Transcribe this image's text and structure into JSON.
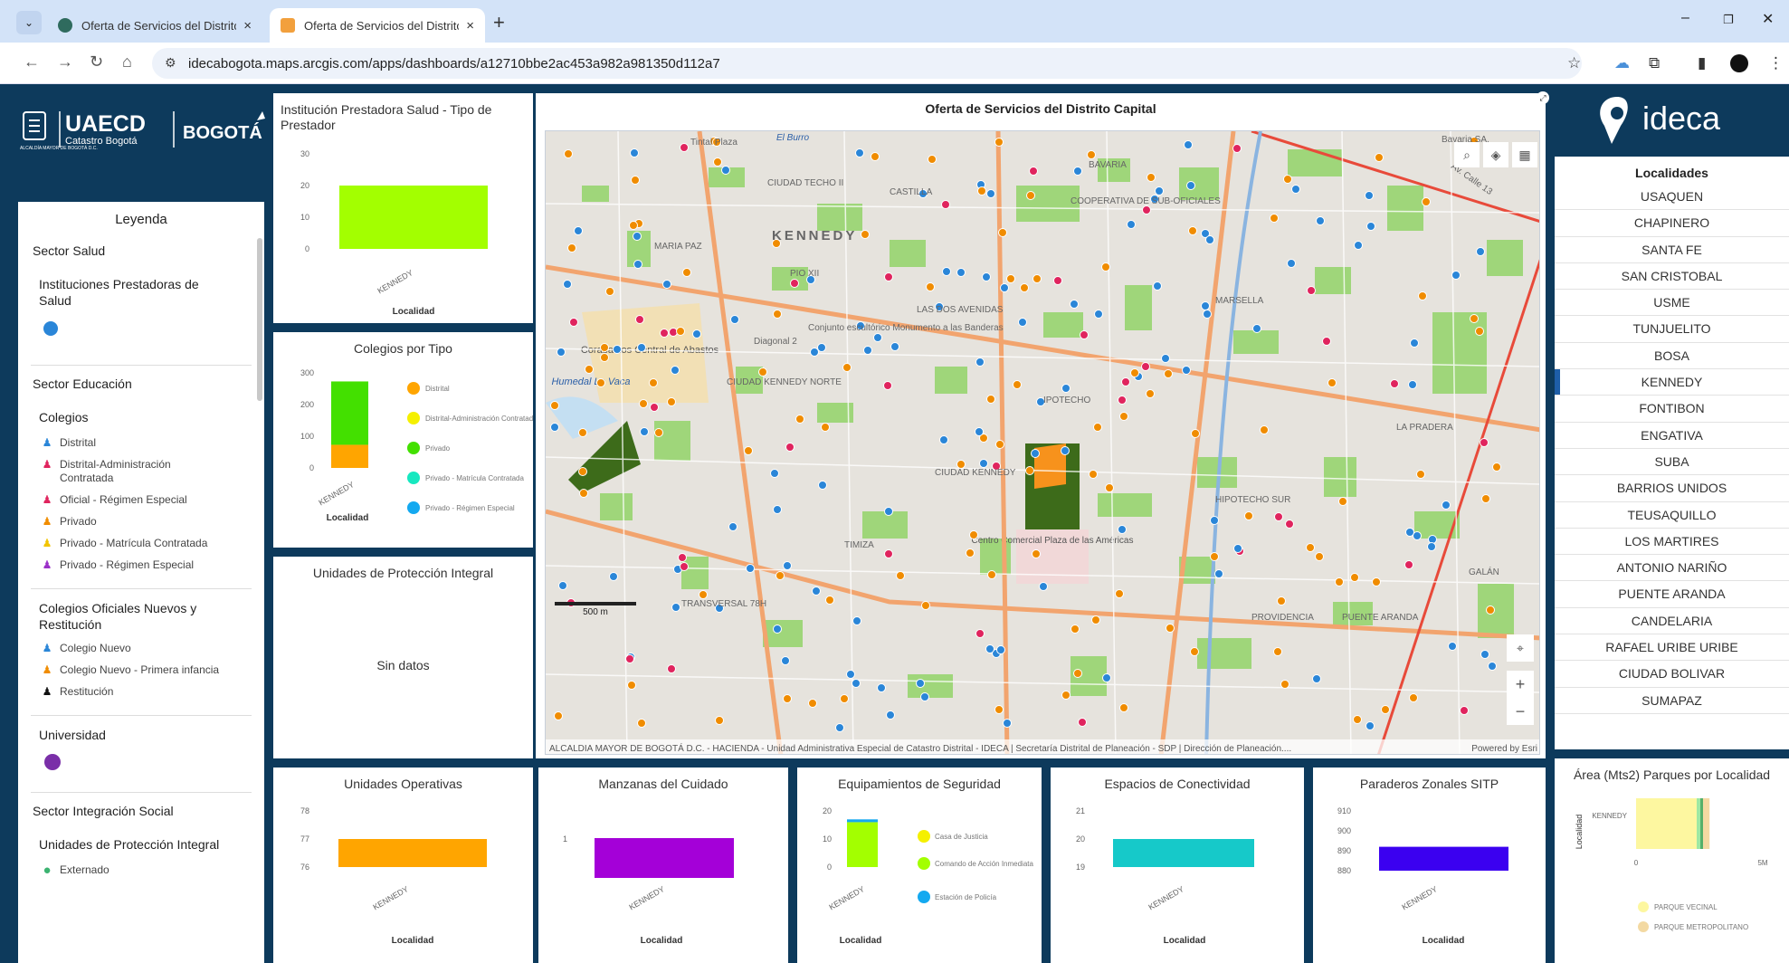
{
  "browser": {
    "tabs": [
      {
        "title": "Oferta de Servicios del Distrito",
        "close": "×"
      },
      {
        "title": "Oferta de Servicios del Distrito",
        "close": "×"
      }
    ],
    "new_tab": "+",
    "url": "idecabogota.maps.arcgis.com/apps/dashboards/a12710bbe2ac453a982a981350d112a7",
    "window_controls": {
      "minimize": "–",
      "restore": "❐",
      "close": "✕"
    }
  },
  "branding": {
    "uaecd": "UAECD",
    "catastro": "Catastro Bogotá",
    "alcaldia": "ALCALDÍA MAYOR DE BOGOTÁ D.C.",
    "bogota": "BOGOTÁ",
    "ideca": "ideca"
  },
  "legend": {
    "title": "Leyenda",
    "salud": {
      "sector": "Sector Salud",
      "sub": "Instituciones Prestadoras de Salud"
    },
    "educacion": {
      "sector": "Sector Educación",
      "colegios": "Colegios",
      "items": [
        "Distrital",
        "Distrital-Administración Contratada",
        "Oficial - Régimen Especial",
        "Privado",
        "Privado - Matrícula Contratada",
        "Privado - Régimen Especial"
      ],
      "nuevos": "Colegios Oficiales Nuevos y Restitución",
      "nuevos_items": [
        "Colegio Nuevo",
        "Colegio Nuevo - Primera infancia",
        "Restitución"
      ],
      "universidad": "Universidad"
    },
    "integracion": {
      "sector": "Sector Integración Social",
      "sub": "Unidades de Protección Integral",
      "items": [
        "Externado"
      ]
    }
  },
  "colors": {
    "navy": "#0d3a5c",
    "lime": "#a3ff00",
    "orange": "#ffa500",
    "purple": "#a400d8",
    "cyan": "#16c9c9",
    "blue": "#3b00f0",
    "accent": "#1e5ea8"
  },
  "ips_chart": {
    "title": "Institución Prestadora Salud - Tipo de Prestador",
    "ticks": [
      "30",
      "20",
      "10",
      "0"
    ],
    "category": "KENNEDY",
    "xlabel": "Localidad",
    "chart_data": {
      "type": "bar",
      "categories": [
        "KENNEDY"
      ],
      "values": [
        20
      ],
      "xlabel": "Localidad",
      "ylim": [
        0,
        30
      ]
    }
  },
  "colegios_chart": {
    "title": "Colegios por Tipo",
    "ticks": [
      "300",
      "200",
      "100",
      "0"
    ],
    "category": "KENNEDY",
    "xlabel": "Localidad",
    "legend": [
      "Distrital",
      "Distrital-Administración Contratada",
      "Privado",
      "Privado - Matrícula Contratada",
      "Privado - Régimen Especial"
    ],
    "chart_data": {
      "type": "bar",
      "stacked": true,
      "categories": [
        "KENNEDY"
      ],
      "series": [
        {
          "name": "Distrital",
          "values": [
            73
          ]
        },
        {
          "name": "Privado",
          "values": [
            200
          ]
        }
      ],
      "xlabel": "Localidad",
      "ylim": [
        0,
        300
      ]
    }
  },
  "upi_panel": {
    "title": "Unidades de Protección Integral",
    "empty": "Sin datos"
  },
  "map": {
    "title": "Oferta de Servicios del Distrito Capital",
    "labels": [
      "KENNEDY",
      "CIUDAD TECHO II",
      "COOPERATIVA DE SUB-OFICIALES",
      "Corabastos Central de Abastos",
      "Humedal La Vaca",
      "CIUDAD KENNEDY NORTE",
      "LAS DOS AVENIDAS",
      "PIO XII",
      "TIMIZA",
      "IPOTECHO",
      "CIUDAD KENNEDY",
      "Centro Comercial Plaza de las Américas",
      "HIPOTECHO SUR",
      "LA PRADERA",
      "MARSELLA",
      "Av. Calle 13",
      "Bavaria SA.",
      "El Burro",
      "Tintal Plaza",
      "MARIA PAZ",
      "CASTILLA",
      "Conjunto escultórico Monumento a las Banderas",
      "Diagonal 2",
      "PROVIDENCIA",
      "GALÁN",
      "PUENTE ARANDA",
      "TRANSVERSAL 78H",
      "BAVARIA"
    ],
    "scale": "500 m",
    "attribution": "ALCALDIA MAYOR DE BOGOTÁ D.C. - HACIENDA - Unidad Administrativa Especial de Catastro Distrital - IDECA | Secretaría Distrital de Planeación - SDP | Dirección de Planeación....",
    "powered": "Powered by Esri"
  },
  "localidades": {
    "title": "Localidades",
    "items": [
      "USAQUEN",
      "CHAPINERO",
      "SANTA FE",
      "SAN CRISTOBAL",
      "USME",
      "TUNJUELITO",
      "BOSA",
      "KENNEDY",
      "FONTIBON",
      "ENGATIVA",
      "SUBA",
      "BARRIOS UNIDOS",
      "TEUSAQUILLO",
      "LOS MARTIRES",
      "ANTONIO NARIÑO",
      "PUENTE ARANDA",
      "CANDELARIA",
      "RAFAEL URIBE URIBE",
      "CIUDAD BOLIVAR",
      "SUMAPAZ"
    ],
    "selected": "KENNEDY"
  },
  "bottom": {
    "operativas": {
      "title": "Unidades Operativas",
      "ticks": [
        "78",
        "77",
        "76"
      ],
      "chart_data": {
        "type": "bar",
        "categories": [
          "KENNEDY"
        ],
        "values": [
          77
        ],
        "xlabel": "Localidad",
        "ylim": [
          76,
          78
        ]
      }
    },
    "manzanas": {
      "title": "Manzanas del Cuidado",
      "ticks": [
        "1"
      ],
      "chart_data": {
        "type": "bar",
        "categories": [
          "KENNEDY"
        ],
        "values": [
          1
        ],
        "xlabel": "Localidad"
      }
    },
    "seguridad": {
      "title": "Equipamientos de Seguridad",
      "ticks": [
        "20",
        "10",
        "0"
      ],
      "legend": [
        "Casa de Justicia",
        "Comando de Acción Inmediata",
        "Estación de Policía"
      ],
      "chart_data": {
        "type": "bar",
        "stacked": true,
        "categories": [
          "KENNEDY"
        ],
        "series": [
          {
            "name": "Comando de Acción Inmediata",
            "values": [
              16
            ]
          },
          {
            "name": "Estación de Policía",
            "values": [
              1
            ]
          }
        ],
        "xlabel": "Localidad",
        "ylim": [
          0,
          20
        ]
      }
    },
    "conectividad": {
      "title": "Espacios de Conectividad",
      "ticks": [
        "21",
        "20",
        "19"
      ],
      "chart_data": {
        "type": "bar",
        "categories": [
          "KENNEDY"
        ],
        "values": [
          20
        ],
        "xlabel": "Localidad",
        "ylim": [
          19,
          21
        ]
      }
    },
    "paraderos": {
      "title": "Paraderos Zonales SITP",
      "ticks": [
        "910",
        "900",
        "890",
        "880"
      ],
      "chart_data": {
        "type": "bar",
        "categories": [
          "KENNEDY"
        ],
        "values": [
          892
        ],
        "xlabel": "Localidad",
        "ylim": [
          880,
          910
        ]
      }
    },
    "parques": {
      "title": "Área (Mts2) Parques por Localidad",
      "ylabel": "Localidad",
      "ticks": [
        "0",
        "5M"
      ],
      "legend": [
        "PARQUE VECINAL",
        "PARQUE METROPOLITANO"
      ],
      "chart_data": {
        "type": "bar",
        "horizontal": true,
        "categories": [
          "KENNEDY"
        ],
        "series": [
          {
            "name": "PARQUE VECINAL",
            "values": [
              2500000
            ]
          },
          {
            "name": "PARQUE METROPOLITANO",
            "values": [
              400000
            ]
          }
        ],
        "ylabel": "Localidad",
        "xlim": [
          0,
          5000000
        ]
      }
    },
    "category": "KENNEDY",
    "xlabel": "Localidad"
  }
}
